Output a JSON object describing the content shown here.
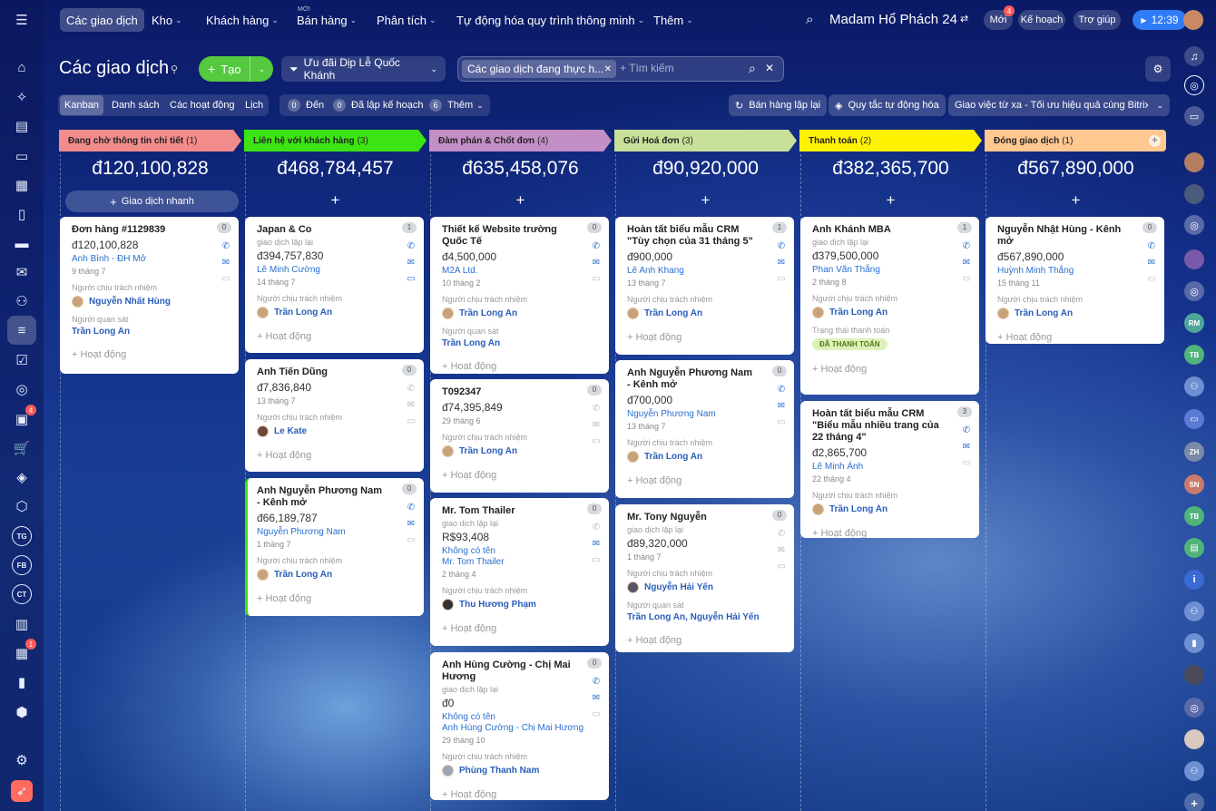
{
  "nav": {
    "items": [
      "Các giao dịch",
      "Kho",
      "Khách hàng",
      "Bán hàng",
      "Phân tích",
      "Tự động hóa quy trình thông minh",
      "Thêm"
    ],
    "new_label": "MỚI",
    "company": "Madam Hổ Phách 24",
    "new_btn": "Mới",
    "new_count": "4",
    "plan_btn": "Kế hoạch",
    "help_btn": "Trợ giúp",
    "timer": "12:39"
  },
  "toolbar": {
    "title": "Các giao dịch",
    "create": "Tạo",
    "pipeline": "Ưu đãi Dịp Lễ Quốc Khánh",
    "filter_tag": "Các giao dịch đang thực h...",
    "search_placeholder": "+ Tìm kiếm"
  },
  "views": {
    "tabs": [
      "Kanban",
      "Danh sách",
      "Các hoạt động",
      "Lịch"
    ],
    "c1": "0",
    "due": "Đến",
    "c2": "0",
    "planned": "Đã lập kế hoạch",
    "c3": "6",
    "more": "Thêm",
    "repeat": "Bán hàng lặp lại",
    "rules": "Quy tắc tự động hóa",
    "remote": "Giao việc từ xa - Tối ưu hiệu quả cùng Bitrix24"
  },
  "sidebar": {
    "b1": "4",
    "b2": "1",
    "l1": "TG",
    "l2": "FB",
    "l3": "CT"
  },
  "rail": [
    "RM",
    "TB",
    "ZH",
    "SN",
    "TB"
  ],
  "quick_deal": "Giao dịch nhanh",
  "add": "+",
  "columns": [
    {
      "name": "Đang chờ thông tin chi tiết",
      "count": "(1)",
      "sum": "đ120,100,828",
      "color": "#f28b8b"
    },
    {
      "name": "Liên hệ với khách hàng",
      "count": "(3)",
      "sum": "đ468,784,457",
      "color": "#3ce412"
    },
    {
      "name": "Đàm phán & Chốt đơn",
      "count": "(4)",
      "sum": "đ635,458,076",
      "color": "#c48ec6"
    },
    {
      "name": "Gửi Hoá đơn",
      "count": "(3)",
      "sum": "đ90,920,000",
      "color": "#c8e09a"
    },
    {
      "name": "Thanh toán",
      "count": "(2)",
      "sum": "đ382,365,700",
      "color": "#fff200"
    },
    {
      "name": "Đóng giao dịch",
      "count": "(1)",
      "sum": "đ567,890,000",
      "color": "#ffc890"
    }
  ],
  "labels": {
    "resp": "Người chịu trách nhiệm",
    "obs": "Người quan sát",
    "act": "+ Hoạt động",
    "pay_status": "Trạng thái thanh toán",
    "repeat": "giao dịch lặp lại"
  },
  "cards": {
    "c0a": {
      "title": "Đơn hàng #1129839",
      "badge": "0",
      "amount": "đ120,100,828",
      "contact": "Anh Bình - ĐH Mở",
      "date": "9 tháng 7",
      "resp": "Nguyễn Nhất Hùng",
      "obs": "Trần Long An"
    },
    "c1a": {
      "title": "Japan & Co",
      "badge": "1",
      "amount": "đ394,757,830",
      "contact": "Lê Minh Cường",
      "date": "14 tháng 7",
      "resp": "Trần Long An"
    },
    "c1b": {
      "title": "Anh Tiến Dũng",
      "badge": "0",
      "amount": "đ7,836,840",
      "date": "13 tháng 7",
      "resp": "Le Kate"
    },
    "c1c": {
      "title": "Anh Nguyễn Phương Nam - Kênh mở",
      "badge": "0",
      "amount": "đ66,189,787",
      "contact": "Nguyễn Phương Nam",
      "date": "1 tháng 7",
      "resp": "Trần Long An"
    },
    "c2a": {
      "title": "Thiết kế Website trường Quốc Tế",
      "badge": "0",
      "amount": "đ4,500,000",
      "contact": "M2A Ltd.",
      "date": "10 tháng 2",
      "resp": "Trần Long An",
      "obs": "Trần Long An"
    },
    "c2b": {
      "title": "T092347",
      "badge": "0",
      "amount": "đ74,395,849",
      "date": "29 tháng 6",
      "resp": "Trần Long An"
    },
    "c2c": {
      "title": "Mr. Tom Thailer",
      "badge": "0",
      "amount": "R$93,408",
      "contact": "Không có tên",
      "contact2": "Mr. Tom Thailer",
      "date": "2 tháng 4",
      "resp": "Thu Hương Phạm"
    },
    "c2d": {
      "title": "Anh Hùng Cường - Chị Mai Hương",
      "badge": "0",
      "amount": "đ0",
      "contact": "Không có tên",
      "contact2": "Anh Hùng Cường - Chị Mai Hương",
      "date": "29 tháng 10",
      "resp": "Phùng Thanh Nam"
    },
    "c3a": {
      "title": "Hoàn tất biểu mẫu CRM \"Tùy chọn của 31 tháng 5\"",
      "badge": "1",
      "amount": "đ900,000",
      "contact": "Lê Anh Khang",
      "date": "13 tháng 7",
      "resp": "Trần Long An"
    },
    "c3b": {
      "title": "Anh Nguyễn Phương Nam - Kênh mở",
      "badge": "0",
      "amount": "đ700,000",
      "contact": "Nguyễn Phương Nam",
      "date": "13 tháng 7",
      "resp": "Trần Long An"
    },
    "c3c": {
      "title": "Mr. Tony Nguyễn",
      "badge": "0",
      "amount": "đ89,320,000",
      "date": "1 tháng 7",
      "resp": "Nguyễn Hải Yến",
      "obs": "Trần Long An, Nguyễn Hải Yến"
    },
    "c4a": {
      "title": "Anh Khánh MBA",
      "badge": "1",
      "amount": "đ379,500,000",
      "contact": "Phan Văn Thắng",
      "date": "2 tháng 8",
      "resp": "Trần Long An",
      "pay": "ĐÃ THANH TOÁN"
    },
    "c4b": {
      "title": "Hoàn tất biểu mẫu CRM \"Biểu mẫu nhiều trang của 22 tháng 4\"",
      "badge": "3",
      "amount": "đ2,865,700",
      "contact": "Lê Minh Ánh",
      "date": "22 tháng 4",
      "resp": "Trần Long An"
    },
    "c5a": {
      "title": "Nguyễn Nhật Hùng - Kênh mở",
      "badge": "0",
      "amount": "đ567,890,000",
      "contact": "Huỳnh Minh Thắng",
      "date": "15 tháng 11",
      "resp": "Trần Long An"
    }
  }
}
